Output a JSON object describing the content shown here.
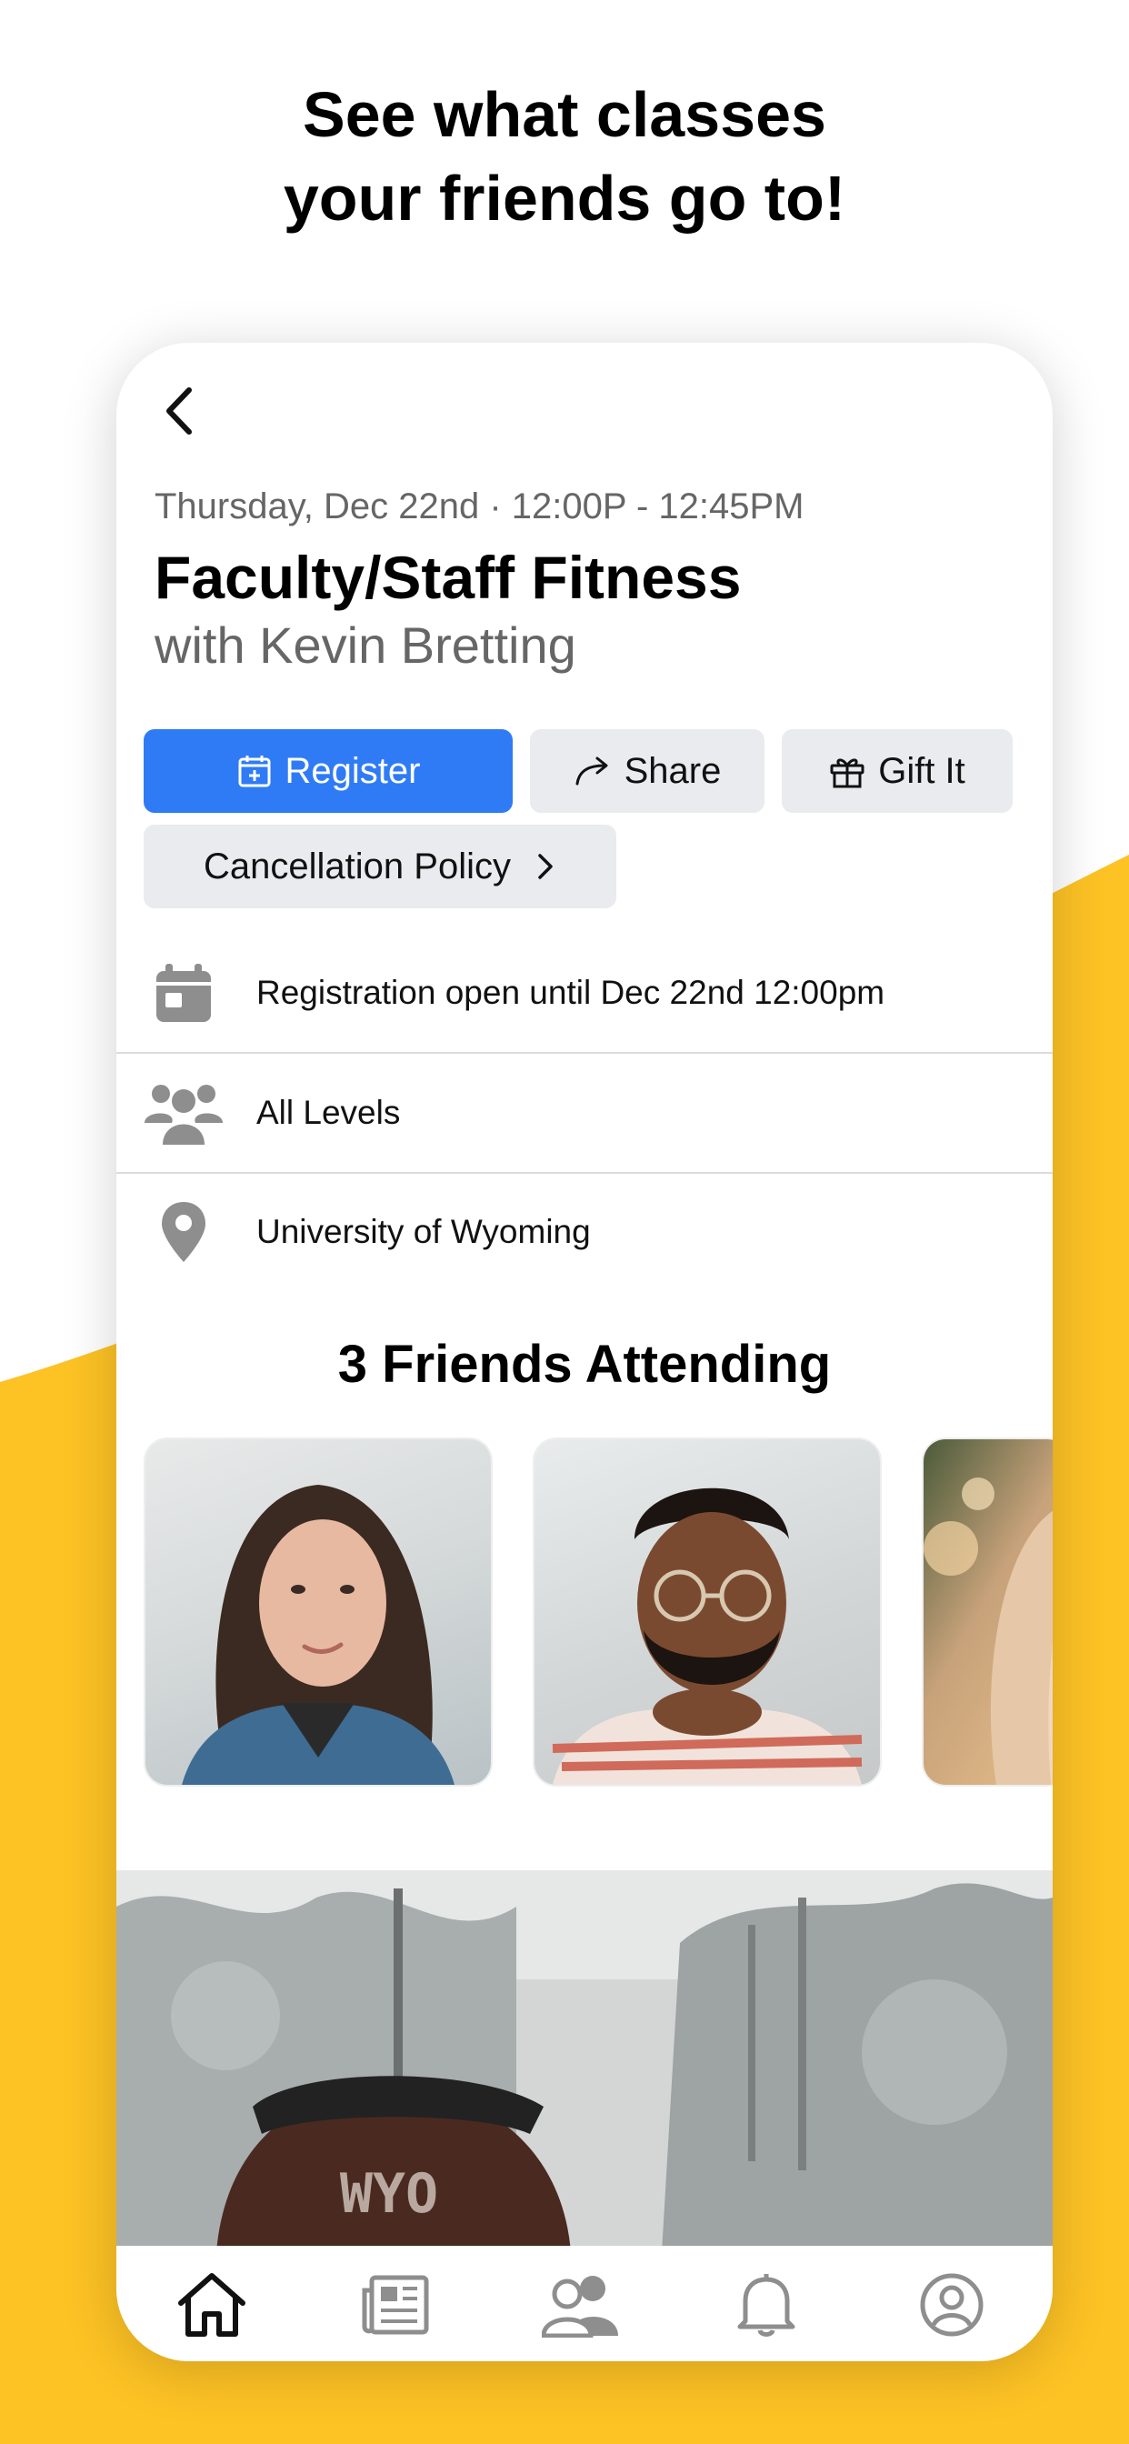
{
  "headline": {
    "line1": "See what classes",
    "line2": "your friends go to!"
  },
  "class": {
    "datetime": "Thursday, Dec 22nd · 12:00P - 12:45PM",
    "title": "Faculty/Staff Fitness",
    "instructor": "with Kevin Bretting"
  },
  "actions": {
    "register": "Register",
    "share": "Share",
    "gift": "Gift It",
    "cancellation": "Cancellation Policy"
  },
  "info": {
    "registration": "Registration open until Dec 22nd 12:00pm",
    "levels": "All Levels",
    "location": "University of Wyoming"
  },
  "friends": {
    "heading": "3 Friends Attending",
    "count": 3
  },
  "icons": {
    "back": "chevron-left-icon",
    "register": "calendar-plus-icon",
    "share": "share-arrow-icon",
    "gift": "gift-icon",
    "cancellation": "chevron-right-icon",
    "registration": "calendar-icon",
    "levels": "group-icon",
    "location": "map-pin-icon",
    "tabs": [
      "home-icon",
      "news-icon",
      "friends-icon",
      "bell-icon",
      "profile-icon"
    ]
  },
  "colors": {
    "accent": "#2F7BF5",
    "background_accent": "#FDC224",
    "button_bg": "#E9EBEE",
    "muted_text": "#666666"
  }
}
